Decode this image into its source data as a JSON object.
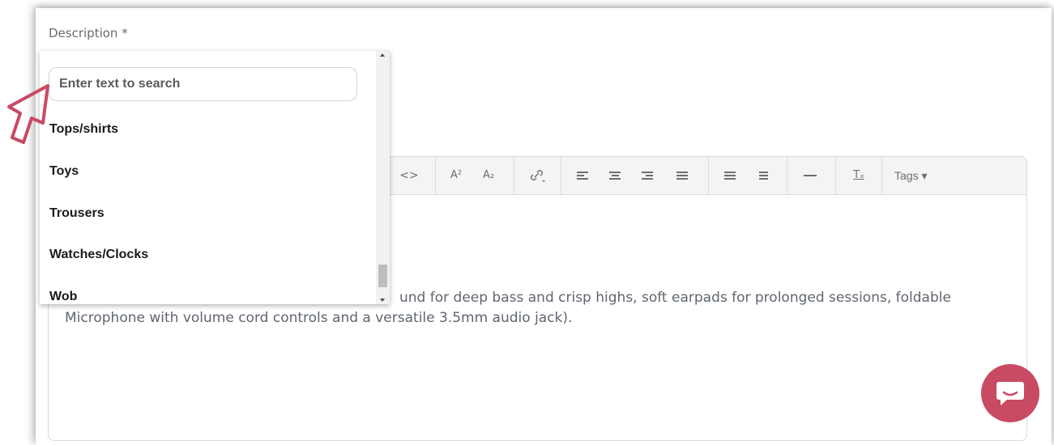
{
  "form": {
    "description_label": "Description *"
  },
  "dropdown": {
    "search_placeholder": "Enter text to search",
    "options": [
      "Tops/shirts",
      "Toys",
      "Trousers",
      "Watches/Clocks",
      "Wob"
    ]
  },
  "editor": {
    "toolbar": {
      "code_label": "<>",
      "superscript_label": "A²",
      "subscript_label": "A₂",
      "link_icon": "link-icon",
      "clear_format_label": "Tₓ",
      "tags_label": "Tags ▾"
    },
    "content_line1": "und for deep bass and crisp highs, soft earpads for prolonged sessions, foldable",
    "content_line2": "Microphone with volume cord controls and a versatile 3.5mm audio jack)."
  },
  "colors": {
    "accent": "#c94a63",
    "toolbar_bg": "#f3f4f6"
  }
}
